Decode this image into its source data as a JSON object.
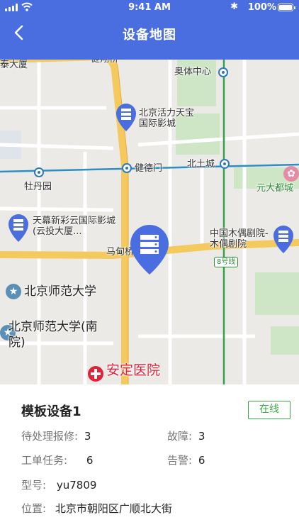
{
  "status_bar": {
    "time": "9:41 AM",
    "battery": "100%"
  },
  "nav": {
    "title": "设备地图"
  },
  "map": {
    "labels": {
      "taida": "泰大厦",
      "jianxiang": "健翔桥",
      "aoti": "奥体中心",
      "huoli": "北京活力天宝国际影城",
      "jiande": "健德门",
      "beitucheng": "北土城",
      "mudan": "牡丹园",
      "yuanda": "元大都城",
      "tianmu": "天幕新彩云国际影城(云投大厦...",
      "muou": "中国木偶剧院-木偶剧院",
      "madian": "马甸桥",
      "line8": "8号线",
      "bnu": "北京师范大学",
      "bnu_south": "北京师范大学(南院)",
      "anding": "安定医院"
    }
  },
  "device": {
    "name": "模板设备1",
    "status": "在线",
    "repair_label": "待处理报修:",
    "repair_value": "3",
    "fault_label": "故障:",
    "fault_value": "3",
    "order_label": "工单任务:",
    "order_value": "6",
    "alarm_label": "告警:",
    "alarm_value": "6",
    "model_label": "型号:",
    "model_value": "yu7809",
    "location_label": "位置:",
    "location_value": "北京市朝阳区广顺北大街"
  }
}
